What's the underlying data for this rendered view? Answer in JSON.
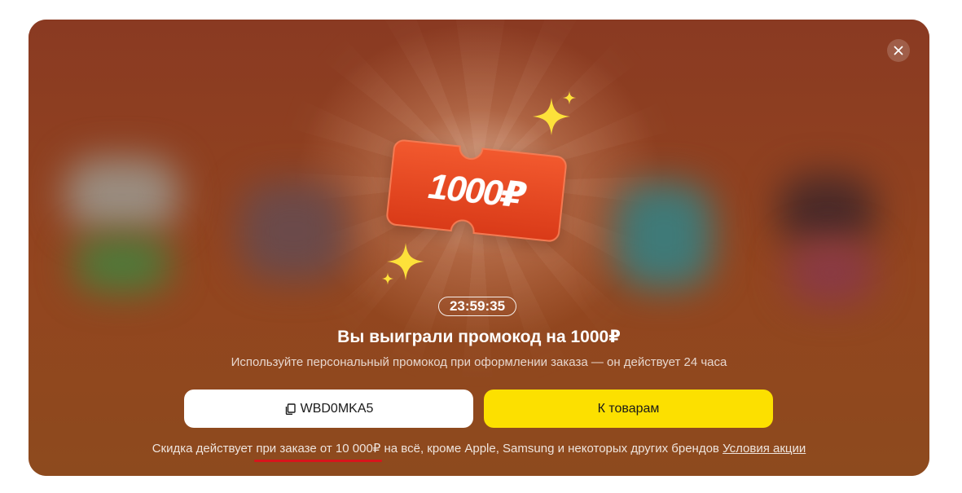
{
  "modal": {
    "close_icon": "close-icon",
    "prize": {
      "amount_text": "1000₽",
      "coupon_color": "#e8451f",
      "sparkle_color": "#fde13a"
    },
    "timer": "23:59:35",
    "title": "Вы выиграли промокод на 1000₽",
    "subtitle": "Используйте персональный промокод при оформлении заказа — он действует 24 часа",
    "promo_button": {
      "icon": "copy-icon",
      "label": "WBD0MKA5"
    },
    "goods_button": {
      "label": "К товарам",
      "color": "#fce000"
    },
    "footer": {
      "text_before": "Скидка действует ",
      "highlight": "при заказе от 10 000₽",
      "text_after": " на всё, кроме Apple, Samsung и некоторых других брендов ",
      "terms_link": "Условия акции",
      "highlight_underline_color": "#d8141c"
    }
  }
}
